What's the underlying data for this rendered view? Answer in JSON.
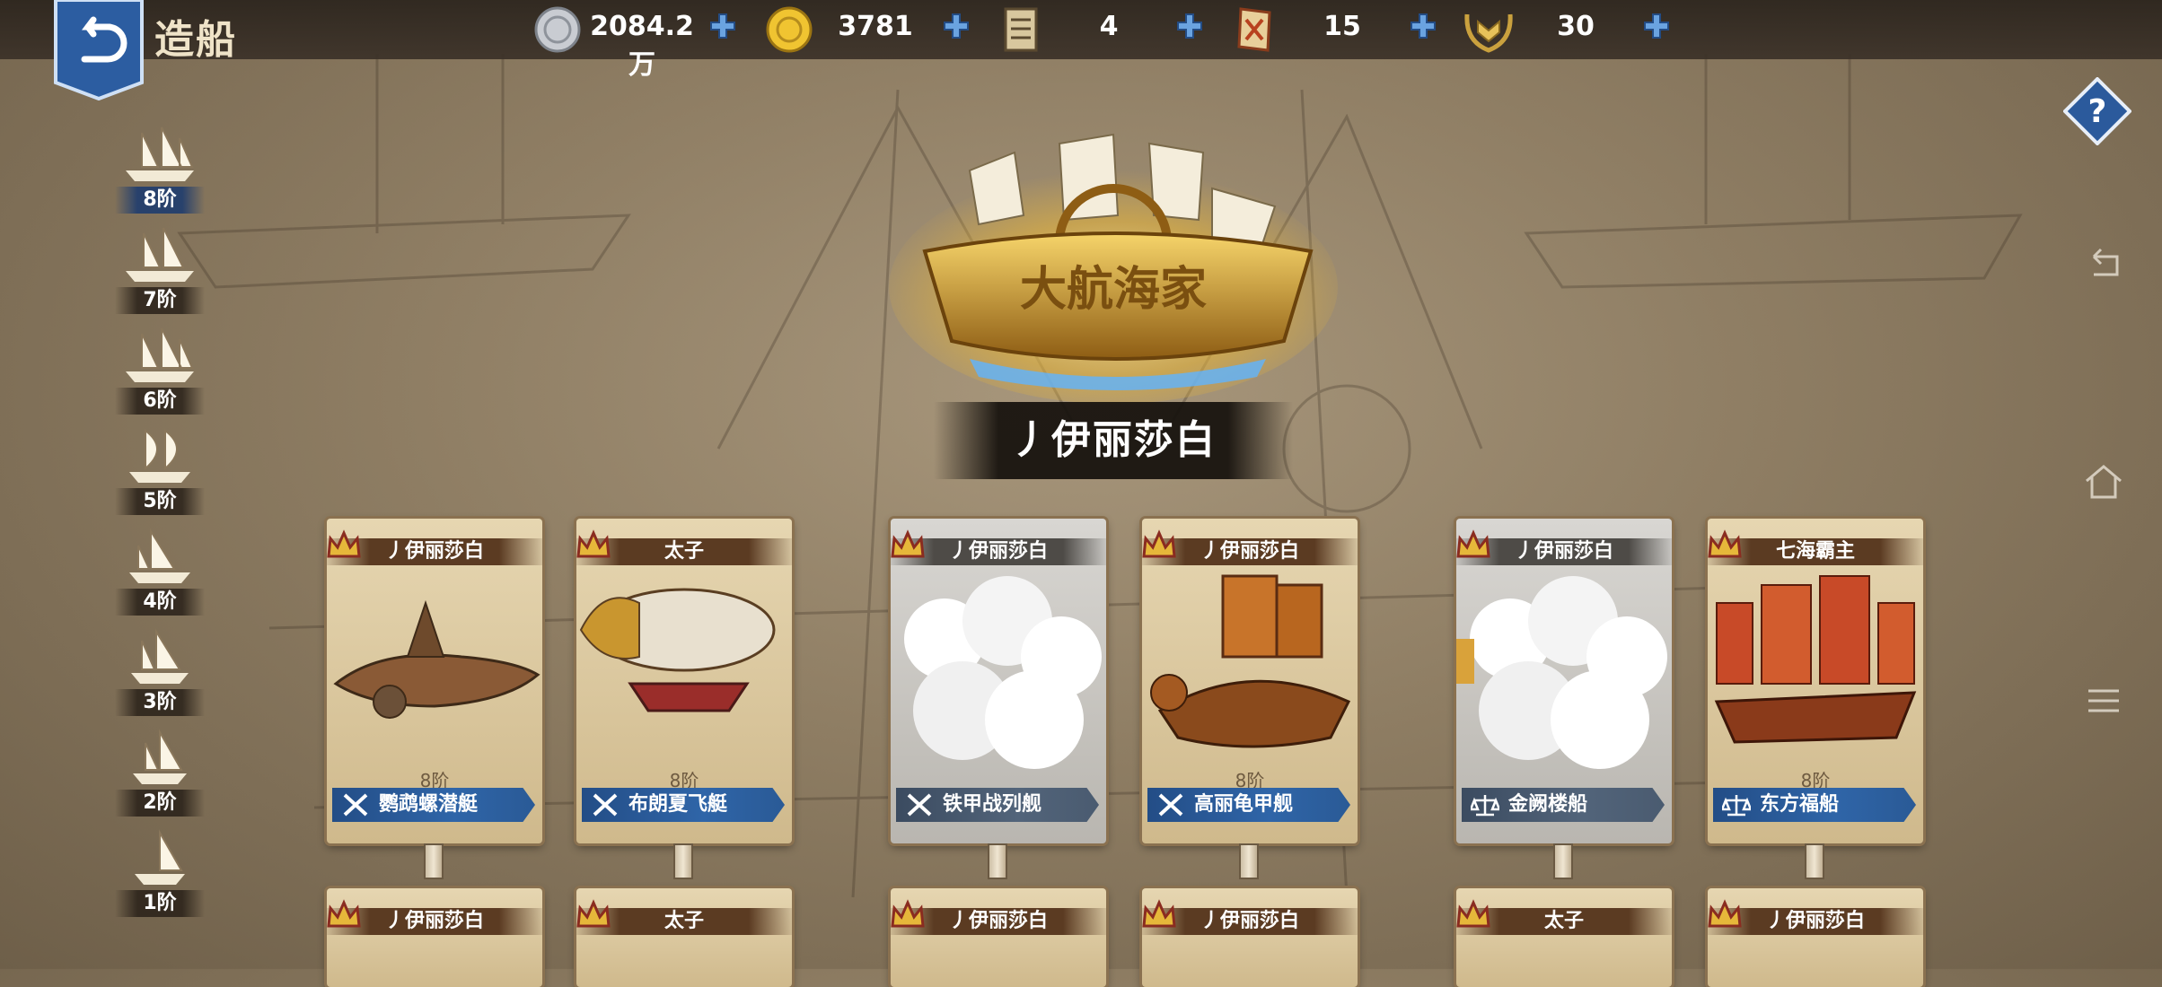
{
  "header": {
    "title": "造船"
  },
  "resources": [
    {
      "name": "silver",
      "value": "2084.2万"
    },
    {
      "name": "gold",
      "value": "3781"
    },
    {
      "name": "scroll",
      "value": "4"
    },
    {
      "name": "blueprint",
      "value": "15"
    },
    {
      "name": "medal",
      "value": "30"
    }
  ],
  "tiers": [
    {
      "label": "8阶",
      "active": true
    },
    {
      "label": "7阶"
    },
    {
      "label": "6阶"
    },
    {
      "label": "5阶"
    },
    {
      "label": "4阶"
    },
    {
      "label": "3阶"
    },
    {
      "label": "2阶"
    },
    {
      "label": "1阶"
    }
  ],
  "hero": {
    "logo_text": "大航海家",
    "name": "丿伊丽莎白"
  },
  "cards": [
    {
      "owner": "丿伊丽莎白",
      "tier": "8阶",
      "ship": "鹦鹉螺潜艇",
      "type": "sword",
      "locked": false
    },
    {
      "owner": "太子",
      "tier": "8阶",
      "ship": "布朗夏飞艇",
      "type": "sword",
      "locked": false
    },
    {
      "owner": "丿伊丽莎白",
      "tier": "",
      "ship": "铁甲战列舰",
      "type": "sword",
      "locked": true
    },
    {
      "owner": "丿伊丽莎白",
      "tier": "8阶",
      "ship": "高丽龟甲舰",
      "type": "sword",
      "locked": false
    },
    {
      "owner": "丿伊丽莎白",
      "tier": "",
      "ship": "金阙楼船",
      "type": "scale",
      "locked": true
    },
    {
      "owner": "七海霸主",
      "tier": "8阶",
      "ship": "东方福船",
      "type": "scale",
      "locked": false
    }
  ],
  "cards_row2": [
    {
      "owner": "丿伊丽莎白"
    },
    {
      "owner": "太子"
    },
    {
      "owner": "丿伊丽莎白"
    },
    {
      "owner": "丿伊丽莎白"
    },
    {
      "owner": "太子"
    },
    {
      "owner": "丿伊丽莎白"
    }
  ],
  "colors": {
    "accent_blue": "#2f65a8",
    "bar_dark": "#2a231c",
    "parchment": "#e6d6b1"
  }
}
